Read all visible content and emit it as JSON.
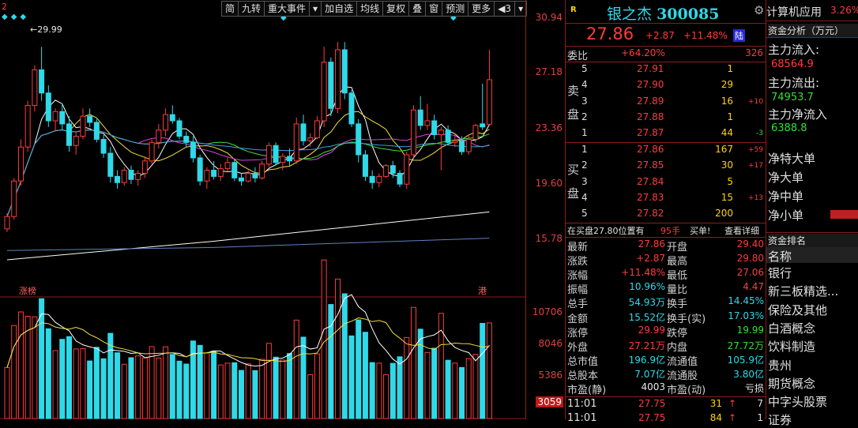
{
  "chart": {
    "top_left_marker": "2",
    "max_label": "29.99",
    "tag_left": "涨榜",
    "tag_right": "港",
    "toolbar": [
      "简",
      "九转",
      "重大事件",
      "▾",
      "加自选",
      "均线",
      "复权",
      "叠",
      "窗",
      "预测",
      "更多",
      "◀3",
      "▾"
    ],
    "price_axis": [
      "30.94",
      "27.18",
      "23.36",
      "19.60",
      "15.78"
    ],
    "volume_axis": [
      "10706",
      "8046",
      "5386",
      "3059"
    ],
    "colors": {
      "up": "#ff3c3c",
      "down": "#2fd9e8",
      "ma5": "#ffffff",
      "ma10": "#f0e040",
      "ma20": "#e040e0",
      "ma30": "#40e040",
      "ma60": "#40a0e0",
      "ma120": "#fffff0",
      "ma250": "#6080c0"
    }
  },
  "chart_data": {
    "type": "candlestick",
    "ylim": [
      14,
      32
    ],
    "candles": [
      [
        18.2,
        19.2,
        18.0,
        19.0
      ],
      [
        19.0,
        21.5,
        18.8,
        21.3
      ],
      [
        21.3,
        24.0,
        21.0,
        23.5
      ],
      [
        23.5,
        26.5,
        23.2,
        26.2
      ],
      [
        26.2,
        28.8,
        25.8,
        28.5
      ],
      [
        28.5,
        29.99,
        26.5,
        27.0
      ],
      [
        27.0,
        27.5,
        24.8,
        25.2
      ],
      [
        25.2,
        26.0,
        24.5,
        25.8
      ],
      [
        25.8,
        26.3,
        24.6,
        25.0
      ],
      [
        25.0,
        25.5,
        23.2,
        23.6
      ],
      [
        23.6,
        24.5,
        23.0,
        24.2
      ],
      [
        24.2,
        26.0,
        24.0,
        25.5
      ],
      [
        25.5,
        26.0,
        24.8,
        25.1
      ],
      [
        25.1,
        25.3,
        23.8,
        24.0
      ],
      [
        24.0,
        24.3,
        22.8,
        23.1
      ],
      [
        23.1,
        23.5,
        21.2,
        21.6
      ],
      [
        21.6,
        22.0,
        20.8,
        21.2
      ],
      [
        21.2,
        22.2,
        21.0,
        22.0
      ],
      [
        22.0,
        22.3,
        21.1,
        21.4
      ],
      [
        21.4,
        22.0,
        21.0,
        21.8
      ],
      [
        21.8,
        22.9,
        21.5,
        22.6
      ],
      [
        22.6,
        24.0,
        22.4,
        23.8
      ],
      [
        23.8,
        25.0,
        23.4,
        24.6
      ],
      [
        24.6,
        26.0,
        24.2,
        25.6
      ],
      [
        25.6,
        26.2,
        25.0,
        25.2
      ],
      [
        25.2,
        25.4,
        24.0,
        24.2
      ],
      [
        24.2,
        24.5,
        23.5,
        23.8
      ],
      [
        23.8,
        24.2,
        22.5,
        22.8
      ],
      [
        22.8,
        23.0,
        21.0,
        21.3
      ],
      [
        21.3,
        22.2,
        20.8,
        22.0
      ],
      [
        22.0,
        22.6,
        21.4,
        21.6
      ],
      [
        21.6,
        22.4,
        21.3,
        22.1
      ],
      [
        22.1,
        22.8,
        21.9,
        22.5
      ],
      [
        22.5,
        22.7,
        21.3,
        21.5
      ],
      [
        21.5,
        21.8,
        21.0,
        21.3
      ],
      [
        21.3,
        22.0,
        21.2,
        21.8
      ],
      [
        21.8,
        22.2,
        21.2,
        21.5
      ],
      [
        21.5,
        22.6,
        21.4,
        22.4
      ],
      [
        22.4,
        23.8,
        22.2,
        23.6
      ],
      [
        23.6,
        23.8,
        22.3,
        22.5
      ],
      [
        22.5,
        23.1,
        22.0,
        22.9
      ],
      [
        22.9,
        23.4,
        22.3,
        22.6
      ],
      [
        22.6,
        25.4,
        22.4,
        25.0
      ],
      [
        25.0,
        25.6,
        23.6,
        23.9
      ],
      [
        23.9,
        24.4,
        23.5,
        24.1
      ],
      [
        24.1,
        25.5,
        24.0,
        25.2
      ],
      [
        25.2,
        30.0,
        24.8,
        29.0
      ],
      [
        29.0,
        29.3,
        25.5,
        26.0
      ],
      [
        26.0,
        30.3,
        25.7,
        29.8
      ],
      [
        29.8,
        30.3,
        26.6,
        27.0
      ],
      [
        27.0,
        27.2,
        24.8,
        25.0
      ],
      [
        25.0,
        25.3,
        22.5,
        23.0
      ],
      [
        23.0,
        23.3,
        21.3,
        21.6
      ],
      [
        21.6,
        22.0,
        20.8,
        21.2
      ],
      [
        21.2,
        21.8,
        20.9,
        21.6
      ],
      [
        21.6,
        22.4,
        21.5,
        22.3
      ],
      [
        22.3,
        22.6,
        21.5,
        21.8
      ],
      [
        21.8,
        22.0,
        20.9,
        21.1
      ],
      [
        21.1,
        23.2,
        20.8,
        23.0
      ],
      [
        23.0,
        26.2,
        22.8,
        25.9
      ],
      [
        25.9,
        26.8,
        24.6,
        24.9
      ],
      [
        24.9,
        26.3,
        24.6,
        25.2
      ],
      [
        25.2,
        25.6,
        24.0,
        24.3
      ],
      [
        24.3,
        24.8,
        22.0,
        24.6
      ],
      [
        24.6,
        24.9,
        23.6,
        23.8
      ],
      [
        23.8,
        24.4,
        23.5,
        23.9
      ],
      [
        23.9,
        24.2,
        23.0,
        23.2
      ],
      [
        23.2,
        24.3,
        23.0,
        24.0
      ],
      [
        24.0,
        25.0,
        23.8,
        24.9
      ],
      [
        25.0,
        27.6,
        24.6,
        24.8
      ]
    ],
    "last_candle": [
      24.98,
      29.8,
      27.06,
      27.86
    ],
    "ma_lines": {
      "ma120": [
        [
          0,
          16.2
        ],
        [
          30,
          17.4
        ],
        [
          70,
          19.3
        ]
      ],
      "ma250": [
        [
          0,
          16.8
        ],
        [
          30,
          17.0
        ],
        [
          70,
          17.6
        ]
      ]
    }
  },
  "quote": {
    "stock_name": "银之杰",
    "code": "300085",
    "price": "27.86",
    "change": "+2.87",
    "pct": "+11.48%",
    "exchange_tag": "陆",
    "r_icon": "R",
    "weibi_label": "委比",
    "weibi_value": "+64.20%",
    "weibi_diff": "326",
    "sell_label": [
      "卖",
      "盘"
    ],
    "buy_label": [
      "买",
      "盘"
    ],
    "asks": [
      {
        "lvl": "5",
        "price": "27.91",
        "vol": "1",
        "chg": ""
      },
      {
        "lvl": "4",
        "price": "27.90",
        "vol": "29",
        "chg": ""
      },
      {
        "lvl": "3",
        "price": "27.89",
        "vol": "16",
        "chg": "+10"
      },
      {
        "lvl": "2",
        "price": "27.88",
        "vol": "1",
        "chg": ""
      },
      {
        "lvl": "1",
        "price": "27.87",
        "vol": "44",
        "chg": "-3"
      }
    ],
    "bids": [
      {
        "lvl": "1",
        "price": "27.86",
        "vol": "167",
        "chg": "+59"
      },
      {
        "lvl": "2",
        "price": "27.85",
        "vol": "30",
        "chg": "+17"
      },
      {
        "lvl": "3",
        "price": "27.84",
        "vol": "5",
        "chg": ""
      },
      {
        "lvl": "4",
        "price": "27.83",
        "vol": "15",
        "chg": "+13"
      },
      {
        "lvl": "5",
        "price": "27.82",
        "vol": "200",
        "chg": ""
      }
    ],
    "notice": {
      "text": "在买盘27.80位置有",
      "vol": "95手",
      "action": "买单!",
      "link": "查看详细"
    },
    "stats": [
      {
        "l1": "最新",
        "v1": "27.86",
        "c1": "red",
        "l2": "开盘",
        "v2": "29.40",
        "c2": "red"
      },
      {
        "l1": "涨跌",
        "v1": "+2.87",
        "c1": "red",
        "l2": "最高",
        "v2": "29.80",
        "c2": "red"
      },
      {
        "l1": "涨幅",
        "v1": "+11.48%",
        "c1": "red",
        "l2": "最低",
        "v2": "27.06",
        "c2": "red"
      },
      {
        "l1": "振幅",
        "v1": "10.96%",
        "c1": "cyan",
        "l2": "量比",
        "v2": "4.47",
        "c2": "red"
      },
      {
        "l1": "总手",
        "v1": "54.93万",
        "c1": "cyan",
        "l2": "换手",
        "v2": "14.45%",
        "c2": "cyan"
      },
      {
        "l1": "金额",
        "v1": "15.52亿",
        "c1": "cyan",
        "l2": "换手(实)",
        "v2": "17.03%",
        "c2": "cyan"
      },
      {
        "l1": "涨停",
        "v1": "29.99",
        "c1": "red",
        "l2": "跌停",
        "v2": "19.99",
        "c2": "green"
      },
      {
        "l1": "外盘",
        "v1": "27.21万",
        "c1": "red",
        "l2": "内盘",
        "v2": "27.72万",
        "c2": "green"
      },
      {
        "l1": "总市值",
        "v1": "196.9亿",
        "c1": "cyan",
        "l2": "流通值",
        "v2": "105.9亿",
        "c2": "cyan"
      },
      {
        "l1": "总股本",
        "v1": "7.07亿",
        "c1": "cyan",
        "l2": "流通股",
        "v2": "3.80亿",
        "c2": "cyan"
      },
      {
        "l1": "市盈(静)",
        "v1": "4003",
        "c1": "white",
        "l2": "市盈(动)",
        "v2": "亏损",
        "c2": "white"
      }
    ],
    "ticks": [
      {
        "time": "11:01",
        "price": "27.75",
        "vol": "31",
        "dir": "↑",
        "n": "7"
      },
      {
        "time": "11:01",
        "price": "27.75",
        "vol": "84",
        "dir": "↑",
        "n": "1"
      }
    ]
  },
  "funds": {
    "sector": "计算机应用",
    "sector_pct": "3.26%",
    "panel_title": "资金分析（万元）",
    "main_in_label": "主力流入:",
    "main_in": "68564.9",
    "main_out_label": "主力流出:",
    "main_out": "74953.7",
    "main_net_label": "主力净流入",
    "main_net": "6388.8",
    "net_items": [
      "净特大单",
      "净大单",
      "净中单",
      "净小单"
    ],
    "rank_title": "资金排名",
    "rank_header": "名称",
    "rank_items": [
      "银行",
      "新三板精选...",
      "保险及其他",
      "白酒概念",
      "饮料制造",
      "贵州",
      "期货概念",
      "中字头股票",
      "证券"
    ]
  }
}
